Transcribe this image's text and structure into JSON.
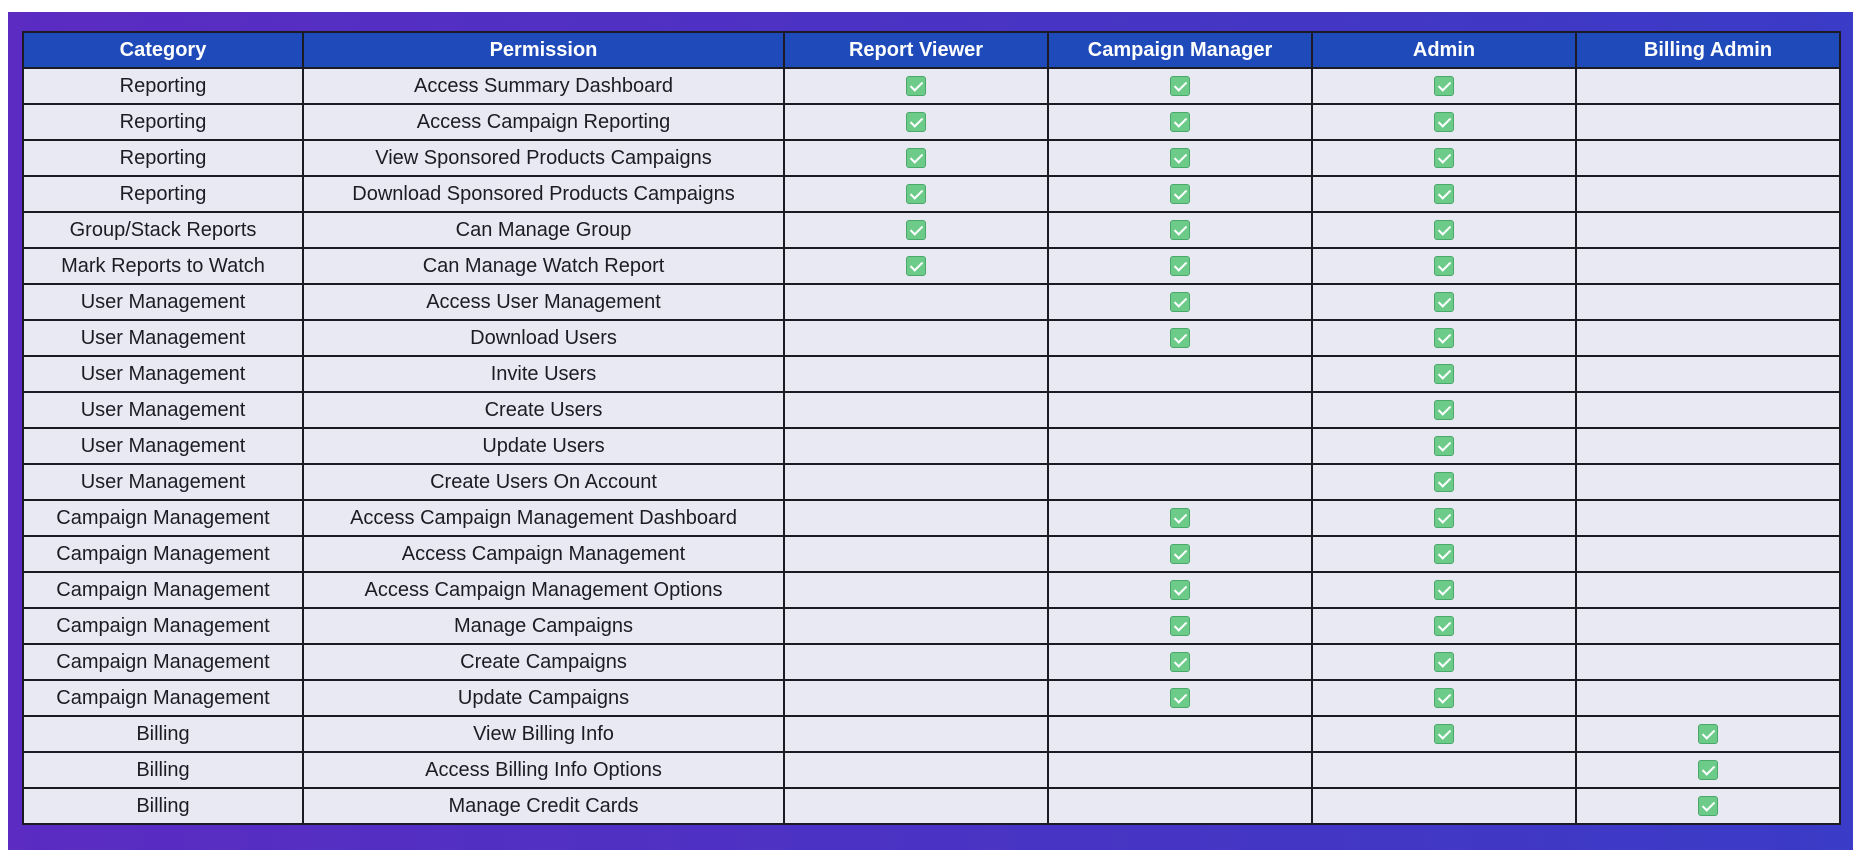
{
  "colors": {
    "frame_gradient_start": "#5b2bc2",
    "frame_gradient_end": "#3a3bc6",
    "header_background": "#1f4ab9",
    "header_text": "#ffffff",
    "row_background": "#e8e9f2",
    "check_fill": "#6dcb8a"
  },
  "columns": [
    "Category",
    "Permission",
    "Report Viewer",
    "Campaign Manager",
    "Admin",
    "Billing Admin"
  ],
  "check_icon": "checkbox-checked-icon",
  "rows": [
    {
      "category": "Reporting",
      "permission": "Access Summary Dashboard",
      "roles": [
        true,
        true,
        true,
        false
      ]
    },
    {
      "category": "Reporting",
      "permission": "Access Campaign Reporting",
      "roles": [
        true,
        true,
        true,
        false
      ]
    },
    {
      "category": "Reporting",
      "permission": "View Sponsored Products Campaigns",
      "roles": [
        true,
        true,
        true,
        false
      ]
    },
    {
      "category": "Reporting",
      "permission": "Download Sponsored Products Campaigns",
      "roles": [
        true,
        true,
        true,
        false
      ]
    },
    {
      "category": "Group/Stack Reports",
      "permission": "Can Manage Group",
      "roles": [
        true,
        true,
        true,
        false
      ]
    },
    {
      "category": "Mark Reports to Watch",
      "permission": "Can Manage Watch Report",
      "roles": [
        true,
        true,
        true,
        false
      ]
    },
    {
      "category": "User Management",
      "permission": "Access User Management",
      "roles": [
        false,
        true,
        true,
        false
      ]
    },
    {
      "category": "User Management",
      "permission": "Download Users",
      "roles": [
        false,
        true,
        true,
        false
      ]
    },
    {
      "category": "User Management",
      "permission": "Invite Users",
      "roles": [
        false,
        false,
        true,
        false
      ]
    },
    {
      "category": "User Management",
      "permission": "Create Users",
      "roles": [
        false,
        false,
        true,
        false
      ]
    },
    {
      "category": "User Management",
      "permission": "Update Users",
      "roles": [
        false,
        false,
        true,
        false
      ]
    },
    {
      "category": "User Management",
      "permission": "Create Users On Account",
      "roles": [
        false,
        false,
        true,
        false
      ]
    },
    {
      "category": "Campaign Management",
      "permission": "Access Campaign Management Dashboard",
      "roles": [
        false,
        true,
        true,
        false
      ]
    },
    {
      "category": "Campaign Management",
      "permission": "Access Campaign Management",
      "roles": [
        false,
        true,
        true,
        false
      ]
    },
    {
      "category": "Campaign Management",
      "permission": "Access Campaign Management Options",
      "roles": [
        false,
        true,
        true,
        false
      ]
    },
    {
      "category": "Campaign Management",
      "permission": "Manage Campaigns",
      "roles": [
        false,
        true,
        true,
        false
      ]
    },
    {
      "category": "Campaign Management",
      "permission": "Create Campaigns",
      "roles": [
        false,
        true,
        true,
        false
      ]
    },
    {
      "category": "Campaign Management",
      "permission": "Update Campaigns",
      "roles": [
        false,
        true,
        true,
        false
      ]
    },
    {
      "category": "Billing",
      "permission": "View Billing Info",
      "roles": [
        false,
        false,
        true,
        true
      ]
    },
    {
      "category": "Billing",
      "permission": "Access Billing Info Options",
      "roles": [
        false,
        false,
        false,
        true
      ]
    },
    {
      "category": "Billing",
      "permission": "Manage Credit Cards",
      "roles": [
        false,
        false,
        false,
        true
      ]
    }
  ]
}
